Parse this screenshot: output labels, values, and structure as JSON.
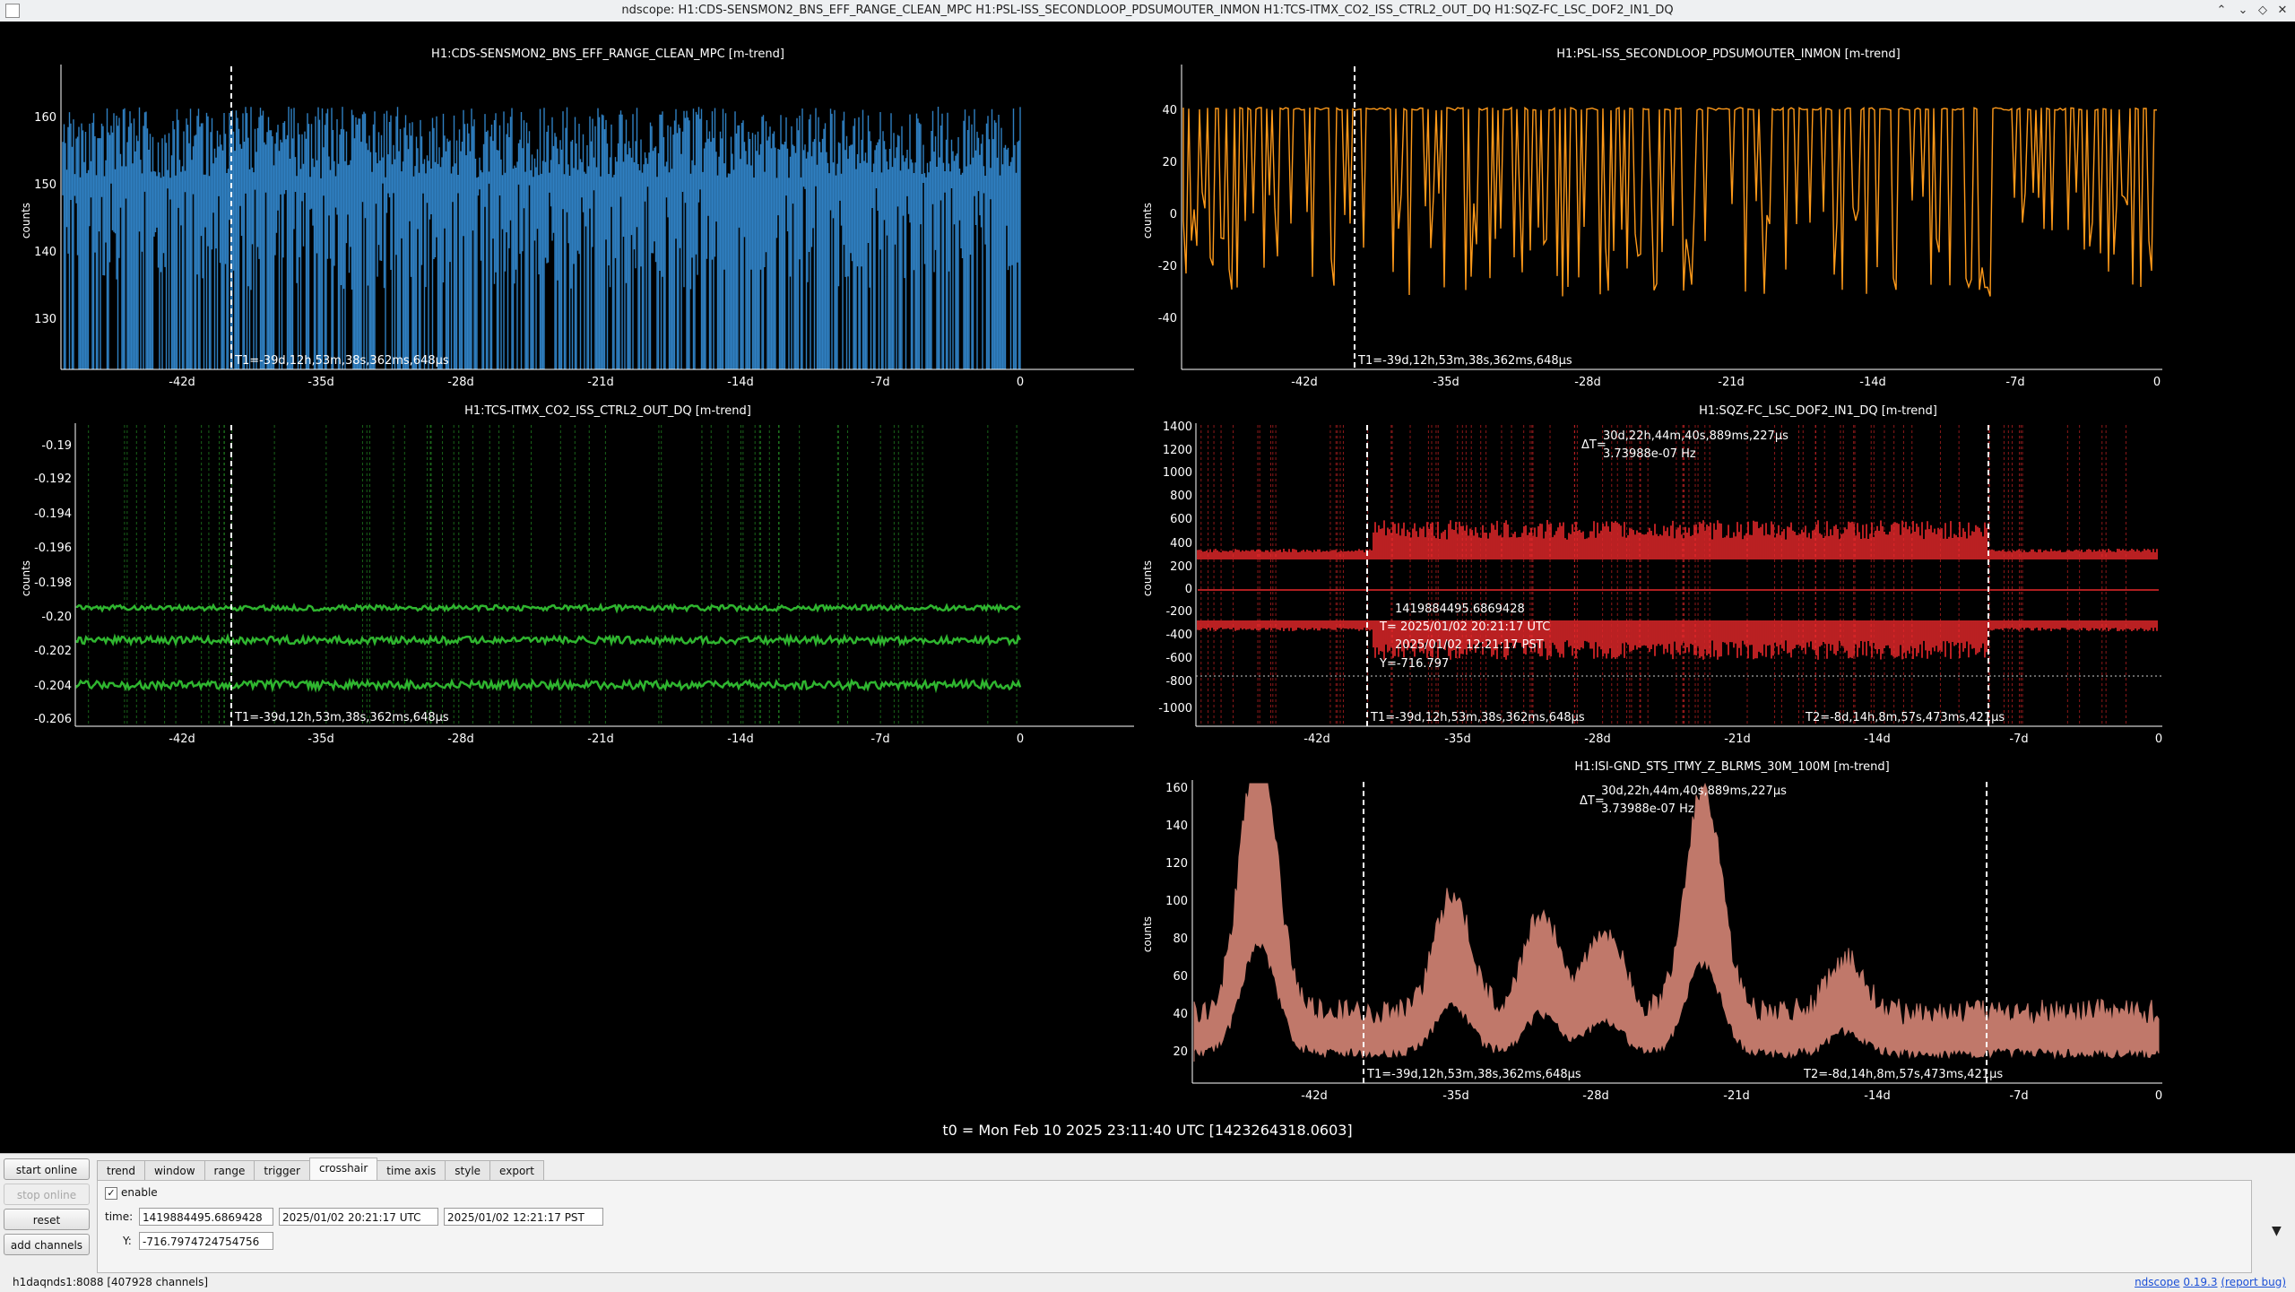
{
  "window": {
    "title": "ndscope: H1:CDS-SENSMON2_BNS_EFF_RANGE_CLEAN_MPC H1:PSL-ISS_SECONDLOOP_PDSUMOUTER_INMON H1:TCS-ITMX_CO2_ISS_CTRL2_OUT_DQ H1:SQZ-FC_LSC_DOF2_IN1_DQ",
    "btn_shade": "⌃",
    "btn_minimize": "⌄",
    "btn_maximize": "◇",
    "btn_close": "✕"
  },
  "t0_label": "t0 = Mon Feb 10 2025 23:11:40 UTC [1423264318.0603]",
  "plots": [
    {
      "title": "H1:CDS-SENSMON2_BNS_EFF_RANGE_CLEAN_MPC [m-trend]",
      "ylabel": "counts",
      "color": "#2f7fc1",
      "yticks": [
        "160",
        "150",
        "140",
        "130"
      ],
      "xticks": [
        "-42d",
        "-35d",
        "-28d",
        "-21d",
        "-14d",
        "-7d",
        "0"
      ],
      "t1": "T1=-39d,12h,53m,38s,362ms,648µs"
    },
    {
      "title": "H1:PSL-ISS_SECONDLOOP_PDSUMOUTER_INMON [m-trend]",
      "ylabel": "counts",
      "color": "#ff9a1a",
      "yticks": [
        "40",
        "20",
        "0",
        "-20",
        "-40"
      ],
      "xticks": [
        "-42d",
        "-35d",
        "-28d",
        "-21d",
        "-14d",
        "-7d",
        "0"
      ],
      "t1": "T1=-39d,12h,53m,38s,362ms,648µs"
    },
    {
      "title": "H1:TCS-ITMX_CO2_ISS_CTRL2_OUT_DQ [m-trend]",
      "ylabel": "counts",
      "color": "#2fb52f",
      "yticks": [
        "-0.19",
        "-0.192",
        "-0.194",
        "-0.196",
        "-0.198",
        "-0.20",
        "-0.202",
        "-0.204",
        "-0.206"
      ],
      "xticks": [
        "-42d",
        "-35d",
        "-28d",
        "-21d",
        "-14d",
        "-7d",
        "0"
      ],
      "t1": "T1=-39d,12h,53m,38s,362ms,648µs"
    },
    {
      "title": "H1:SQZ-FC_LSC_DOF2_IN1_DQ [m-trend]",
      "ylabel": "counts",
      "color": "#e8282b",
      "yticks": [
        "1400",
        "1200",
        "1000",
        "800",
        "600",
        "400",
        "200",
        "0",
        "-200",
        "-400",
        "-600",
        "-800",
        "-1000"
      ],
      "xticks": [
        "-42d",
        "-35d",
        "-28d",
        "-21d",
        "-14d",
        "-7d",
        "0"
      ],
      "t1": "T1=-39d,12h,53m,38s,362ms,648µs",
      "t2": "T2=-8d,14h,8m,57s,473ms,421µs",
      "delta_label": "ΔT=",
      "delta_time": "30d,22h,44m,40s,889ms,227µs",
      "delta_freq": "3.73988e-07 Hz",
      "crosshair": {
        "gps": "1419884495.6869428",
        "utc": "T= 2025/01/02 20:21:17 UTC",
        "pst": "2025/01/02 12:21:17 PST",
        "y": "Y=-716.797"
      }
    },
    {
      "title": "H1:ISI-GND_STS_ITMY_Z_BLRMS_30M_100M [m-trend]",
      "ylabel": "counts",
      "color": "#c0786a",
      "yticks": [
        "160",
        "140",
        "120",
        "100",
        "80",
        "60",
        "40",
        "20"
      ],
      "xticks": [
        "-42d",
        "-35d",
        "-28d",
        "-21d",
        "-14d",
        "-7d",
        "0"
      ],
      "t1": "T1=-39d,12h,53m,38s,362ms,648µs",
      "t2": "T2=-8d,14h,8m,57s,473ms,421µs",
      "delta_label": "ΔT=",
      "delta_time": "30d,22h,44m,40s,889ms,227µs",
      "delta_freq": "3.73988e-07 Hz"
    }
  ],
  "controls": {
    "start_online": "start online",
    "stop_online": "stop online",
    "reset": "reset",
    "add_channels": "add channels",
    "tabs": [
      "trend",
      "window",
      "range",
      "trigger",
      "crosshair",
      "time axis",
      "style",
      "export"
    ],
    "active_tab": "crosshair",
    "enable_check": "✓",
    "enable_label": "enable",
    "time_label": "time:",
    "time_gps": "1419884495.6869428",
    "time_utc": "2025/01/02 20:21:17 UTC",
    "time_pst": "2025/01/02 12:21:17 PST",
    "y_label": "Y:",
    "y_value": "-716.7974724754756"
  },
  "status": {
    "server": "h1daqnds1:8088  [407928 channels]",
    "app_name": "ndscope",
    "version": "0.19.3",
    "report_bug": "(report bug)"
  }
}
